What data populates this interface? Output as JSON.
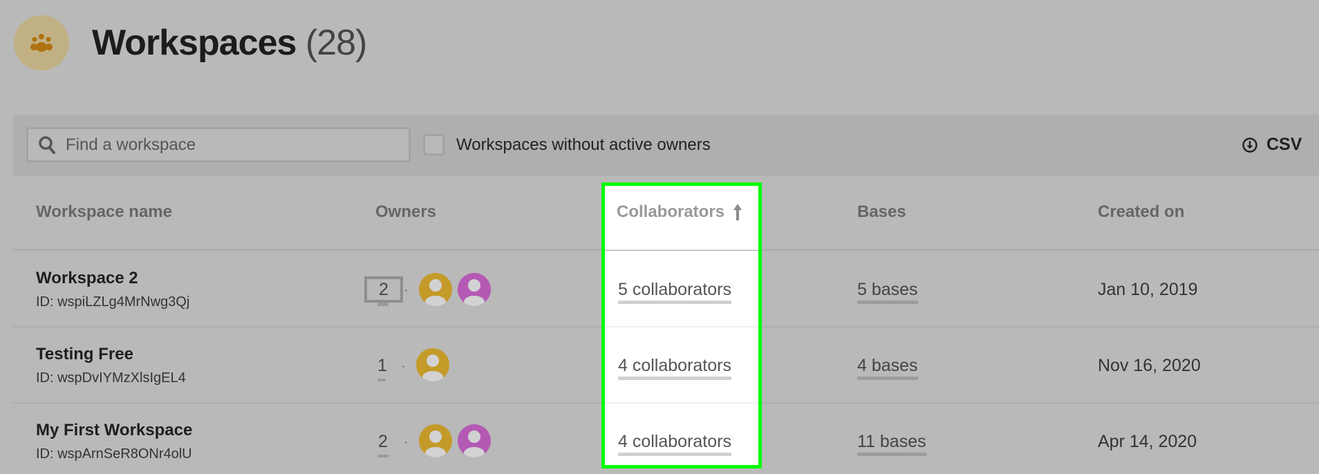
{
  "header": {
    "title": "Workspaces",
    "count": "(28)",
    "icon": "users-group-icon",
    "icon_bg": "#c1b083",
    "icon_color": "#b0720e"
  },
  "toolbar": {
    "search_placeholder": "Find a workspace",
    "search_value": "",
    "filter_label": "Workspaces without active owners",
    "filter_checked": false,
    "csv_label": "CSV"
  },
  "columns": {
    "name": "Workspace name",
    "owners": "Owners",
    "collaborators": "Collaborators",
    "bases": "Bases",
    "created": "Created on",
    "sort_column": "collaborators",
    "sort_direction": "ascending"
  },
  "rows": [
    {
      "name": "Workspace 2",
      "id": "ID: wspiLZLg4MrNwg3Qj",
      "owner_count": "2",
      "owner_colors": [
        "#c49a28",
        "#b459b4"
      ],
      "collaborators": "5 collaborators",
      "bases": "5 bases",
      "created": "Jan 10, 2019"
    },
    {
      "name": "Testing Free",
      "id": "ID: wspDvIYMzXlsIgEL4",
      "owner_count": "1",
      "owner_colors": [
        "#c49a28"
      ],
      "collaborators": "4 collaborators",
      "bases": "4 bases",
      "created": "Nov 16, 2020"
    },
    {
      "name": "My First Workspace",
      "id": "ID: wspArnSeR8ONr4olU",
      "owner_count": "2",
      "owner_colors": [
        "#c49a28",
        "#b459b4"
      ],
      "collaborators": "4 collaborators",
      "bases": "11 bases",
      "created": "Apr 14, 2020"
    }
  ],
  "highlight_color": "#00ff00"
}
